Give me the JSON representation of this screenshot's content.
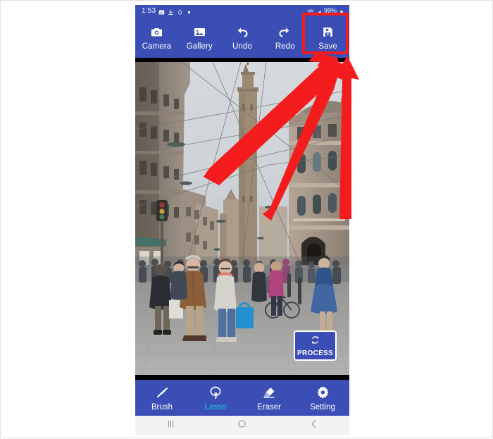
{
  "app": {
    "name": "photo-editor",
    "accent_color": "#3b4eb6",
    "active_tool_color": "#22c8e8",
    "annotation_color": "#f41c1c"
  },
  "status_bar": {
    "time": "1:53",
    "left_icons": [
      "image-icon",
      "download-icon",
      "drop-icon",
      "dot-icon"
    ],
    "right_icons": [
      "wifi-icon",
      "signal-icon",
      "battery-icon"
    ],
    "battery_text": "99%"
  },
  "top_toolbar": {
    "items": [
      {
        "label": "Camera",
        "icon": "camera-icon"
      },
      {
        "label": "Gallery",
        "icon": "gallery-icon"
      },
      {
        "label": "Undo",
        "icon": "undo-icon"
      },
      {
        "label": "Redo",
        "icon": "redo-icon"
      },
      {
        "label": "Save",
        "icon": "save-icon"
      }
    ]
  },
  "canvas": {
    "help_label": "?",
    "process_button": {
      "label": "PROCESS",
      "icon": "refresh-icon"
    }
  },
  "bottom_toolbar": {
    "items": [
      {
        "label": "Brush",
        "icon": "brush-icon",
        "active": false
      },
      {
        "label": "Lasso",
        "icon": "lasso-icon",
        "active": true
      },
      {
        "label": "Eraser",
        "icon": "eraser-icon",
        "active": false
      },
      {
        "label": "Setting",
        "icon": "gear-icon",
        "active": false
      }
    ]
  },
  "nav_bar": {
    "items": [
      {
        "name": "recents-button",
        "icon": "recents-icon"
      },
      {
        "name": "home-button",
        "icon": "home-icon"
      },
      {
        "name": "back-button",
        "icon": "back-icon"
      }
    ]
  },
  "annotations": {
    "highlight_target": "Save",
    "arrow_count": 3
  }
}
